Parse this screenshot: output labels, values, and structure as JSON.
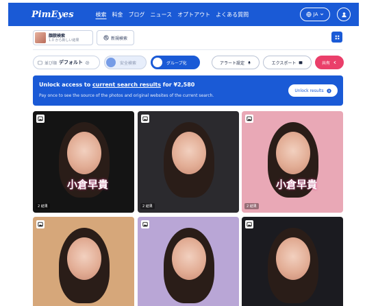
{
  "nav": {
    "logo": "PimEyes",
    "links": [
      "検索",
      "料金",
      "ブログ",
      "ニュース",
      "オプトアウト",
      "よくある質問"
    ],
    "lang": "JA"
  },
  "search_tab": {
    "title": "顔貌検索",
    "subtitle": "1.0 から新しい結果"
  },
  "new_search_label": "新規検索",
  "filters": {
    "sort_prefix": "並び順",
    "sort_value": "デフォルト",
    "safe_search_label": "安全検索",
    "group_label": "グループ化",
    "alert_label": "アラート設定",
    "export_label": "エクスポート",
    "share_label": "共有"
  },
  "banner": {
    "title_pre": "Unlock access to ",
    "title_link": "current search results",
    "title_post": " for ¥2,580",
    "subtitle": "Pay once to see the source of the photos and original websites of the current search.",
    "button_label": "Unlock results"
  },
  "results": [
    {
      "count": "2 結果",
      "sign": "小倉早貴",
      "bg": "#141414"
    },
    {
      "count": "2 結果",
      "sign": "",
      "bg": "#2b2a2e"
    },
    {
      "count": "2 結果",
      "sign": "小倉早貴",
      "bg": "#e9a8b6"
    },
    {
      "count": "",
      "sign": "",
      "bg": "#d6a77a"
    },
    {
      "count": "",
      "sign": "",
      "bg": "#b9a6d6"
    },
    {
      "count": "",
      "sign": "",
      "bg": "#1b1b20"
    }
  ],
  "colors": {
    "brand": "#1a5ad6",
    "share": "#ea3f6a"
  }
}
